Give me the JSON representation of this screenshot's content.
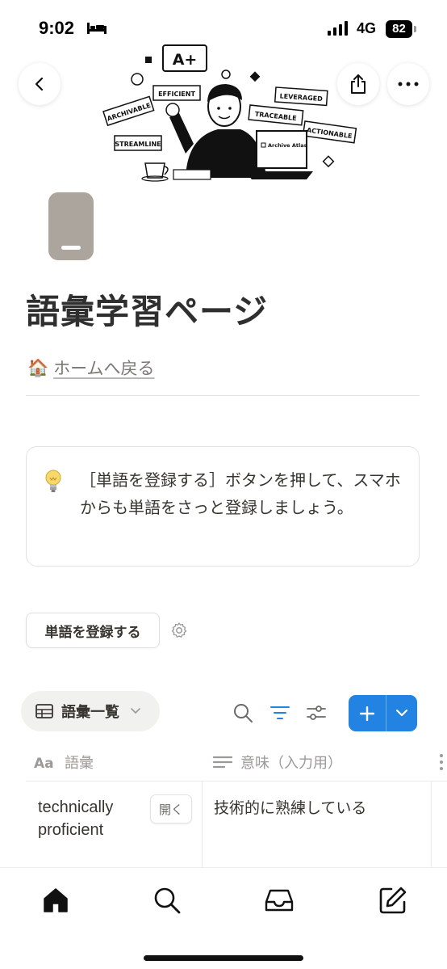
{
  "status_bar": {
    "time": "9:02",
    "network": "4G",
    "battery": "82"
  },
  "cover": {
    "badge_text": "A+",
    "tags": [
      "EFFICIENT",
      "ARCHIVABLE",
      "STREAMLINE",
      "LEVERAGED",
      "TRACEABLE",
      "ACTIONABLE"
    ],
    "laptop_label": "Archive Atlas"
  },
  "page": {
    "title": "語彙学習ページ",
    "home_link_emoji": "🏠",
    "home_link": "ホームへ戻る"
  },
  "callout": {
    "icon": "lightbulb-icon",
    "text": "［単語を登録する］ボタンを押して、スマホからも単語をさっと登録しましょう。"
  },
  "actions": {
    "register_button": "単語を登録する"
  },
  "database": {
    "view_name": "語彙一覧",
    "columns": [
      {
        "label": "語彙",
        "icon": "title-icon"
      },
      {
        "label": "意味（入力用）",
        "icon": "text-icon"
      }
    ],
    "rows": [
      {
        "term": "technically proficient",
        "open_label": "開く",
        "meaning": "技術的に熟練している"
      }
    ]
  },
  "colors": {
    "accent": "#2383e2",
    "text": "#37352f",
    "muted": "#9b9a97",
    "page_icon": "#aba59d"
  }
}
